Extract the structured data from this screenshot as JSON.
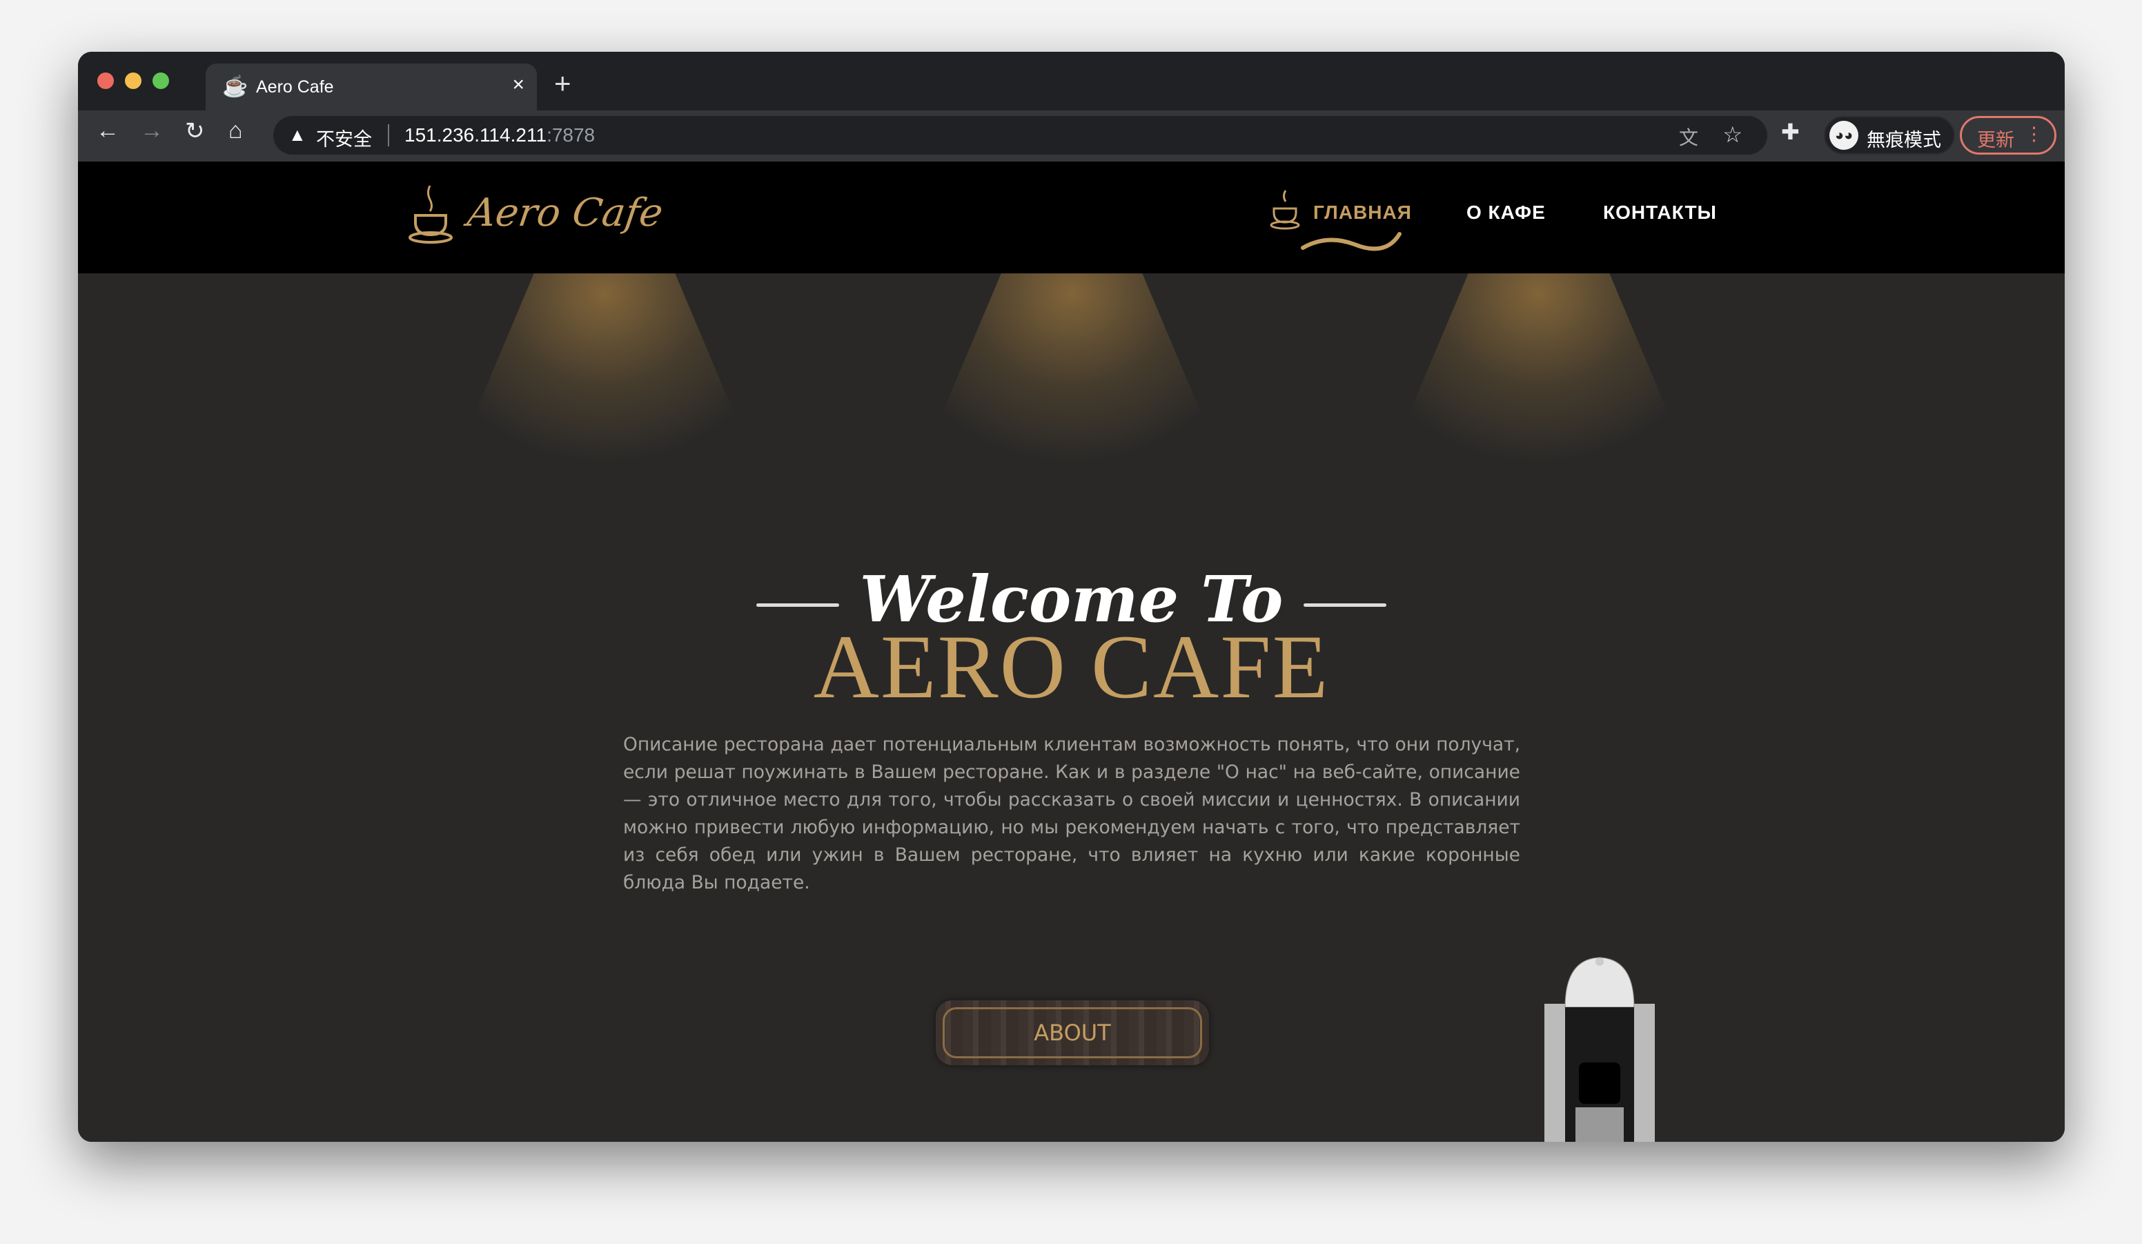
{
  "browser": {
    "tab_title": "Aero Cafe",
    "tab_close": "×",
    "new_tab": "+",
    "security_label": "不安全",
    "url_host": "151.236.114.211",
    "url_port": ":7878",
    "profile_label": "無痕模式",
    "update_label": "更新",
    "nav_icons": [
      "back-icon",
      "forward-icon",
      "reload-icon",
      "home-icon",
      "translate-icon",
      "star-icon",
      "extensions-icon",
      "incognito-icon",
      "more-icon"
    ]
  },
  "site": {
    "logo_text": "Aero Cafe",
    "nav": [
      "ГЛАВНАЯ",
      "О КАФЕ",
      "КОНТАКТЫ"
    ],
    "welcome": "Welcome To",
    "title": "AERO CAFE",
    "description": "Описание ресторана дает потенциальным клиентам возможность понять, что они получат, если решат поужинать в Вашем ресторане. Как и в разделе \"О нас\" на веб-сайте, описание — это отличное место для того, чтобы рассказать о своей миссии и ценностях. В описании можно привести любую информацию, но мы рекомендуем начать с того, что представляет из себя обед или ужин в Вашем ресторане, что влияет на кухню или какие коронные блюда Вы подаете.",
    "about_button": "ABOUT"
  },
  "colors": {
    "accent": "#c59e62",
    "background": "#292827",
    "nav": "#000000",
    "update": "#e0786b"
  }
}
